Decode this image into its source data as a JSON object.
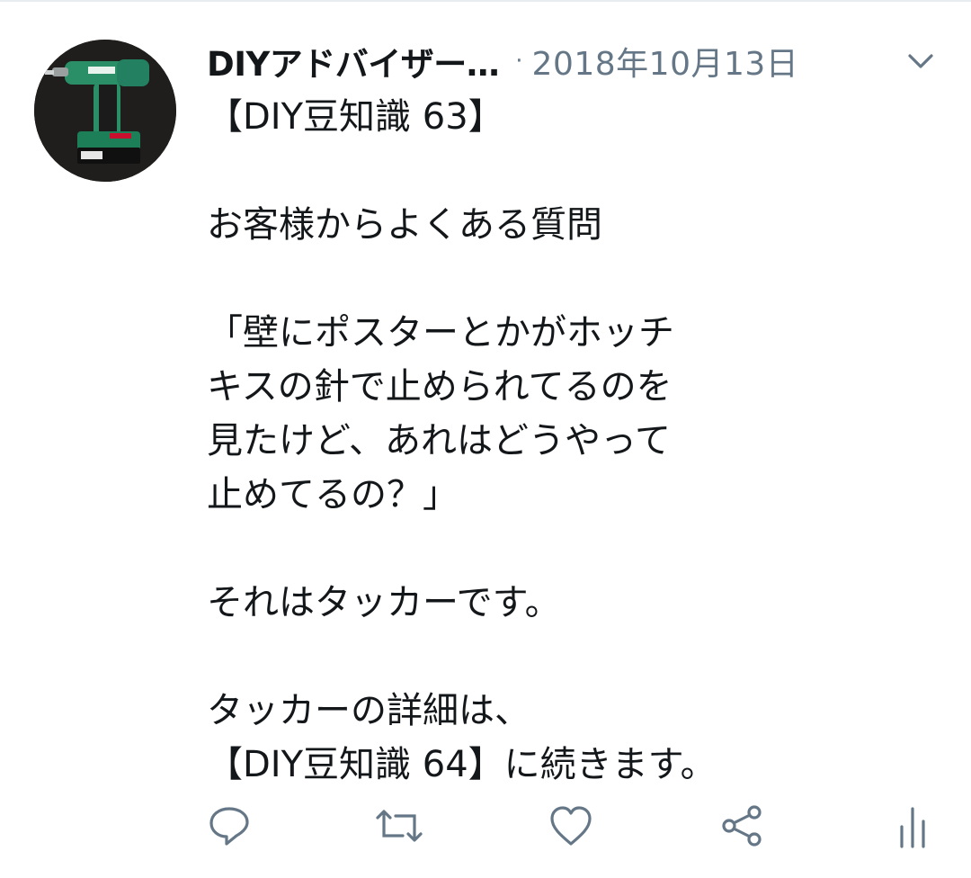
{
  "tweet": {
    "author": {
      "display_name": "DIYアドバイザー…",
      "avatar_icon": "impact-driver-avatar"
    },
    "separator": "·",
    "timestamp": "2018年10月13日",
    "menu_icon": "chevron-down-icon",
    "text_lines": [
      "【DIY豆知識 63】",
      "",
      "お客様からよくある質問",
      "",
      "「壁にポスターとかがホッチ",
      "キスの針で止められてるのを",
      "見たけど、あれはどうやって",
      "止めてるの？」",
      "",
      "それはタッカーです。",
      "",
      "タッカーの詳細は、",
      "【DIY豆知識 64】に続きます。"
    ],
    "actions": [
      {
        "name": "reply-icon"
      },
      {
        "name": "retweet-icon"
      },
      {
        "name": "like-icon"
      },
      {
        "name": "share-icon"
      },
      {
        "name": "analytics-icon"
      }
    ]
  },
  "colors": {
    "text": "#14171a",
    "secondary": "#657786",
    "icon": "#657786",
    "divider": "#e6ecf0",
    "avatar_bg": "#1f1e1c",
    "tool_green": "#1f9a6e"
  }
}
